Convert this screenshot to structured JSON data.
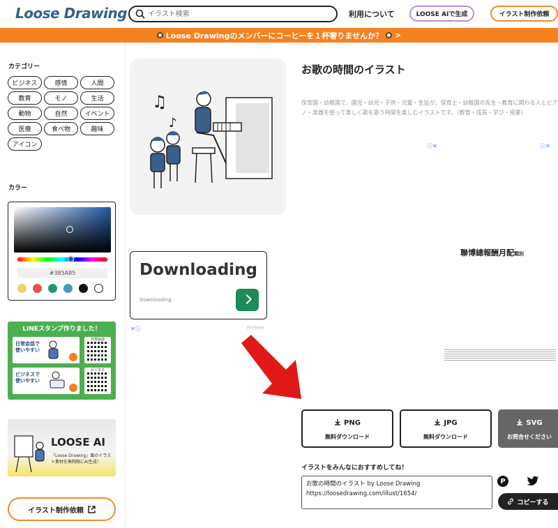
{
  "header": {
    "logo": "Loose Drawing",
    "search_placeholder": "イラスト検索",
    "about": "利用について",
    "ai_button": "LOOSE AIで生成",
    "request_button": "イラスト制作依頼"
  },
  "banner": {
    "text": "Loose Drawingのメンバーにコーヒーを１杯奢りませんか？",
    "arrow": ">"
  },
  "sidebar": {
    "category_title": "カテゴリー",
    "categories": [
      "ビジネス",
      "感情",
      "人間",
      "教育",
      "モノ",
      "生活",
      "動物",
      "自然",
      "イベント",
      "医療",
      "食べ物",
      "趣味",
      "アイコン"
    ],
    "color_title": "カラー",
    "hex_value": "#385A85",
    "swatches": [
      "#e8d66e",
      "#e0534d",
      "#1e9a6a",
      "#4a9ac0",
      "#111111",
      "#ffffff"
    ],
    "line_promo": {
      "title": "LINEスタンプ作りました！",
      "card1": "日常会話で\n使いやすい",
      "card2": "ビジネスで\n使いやすい",
      "qr1": "日常会話",
      "qr2": "ビジネス"
    },
    "ai_promo": {
      "title": "LOOSE AI",
      "subtitle": "「Loose Drawing」風のイラスト素材を無制限にAI生成！"
    },
    "request_button": "イラスト制作依頼"
  },
  "main": {
    "title": "お歌の時間のイラスト",
    "description": "保育園・幼稚園で、園児・幼児・子供・児童・生徒が、保育士・幼稚園の先生・教育に関わる人とピアノ・楽器を使って楽しく歌を歌う時間を楽しむイラストです。（教育・成長・学び・授業）",
    "ad": {
      "headline": "Downloading",
      "small": "Downloading",
      "x": "✕ⓘ",
      "pref": "Prefere"
    },
    "adchoice": "ⓘ✕",
    "ad_text": "聯博總報酬月配",
    "ad_text_small": "類別",
    "downloads": [
      {
        "label": "PNG",
        "sub": "無料ダウンロード"
      },
      {
        "label": "JPG",
        "sub": "無料ダウンロード"
      },
      {
        "label": "SVG",
        "sub": "お問合せください"
      }
    ],
    "share_title": "イラストをみんなにおすすめしてね！",
    "share_text": "お歌の時間のイラスト by Loose Drawing\nhttps://loosedrawing.com/illust/1654/",
    "copy_button": "コピーする",
    "pinterest": "P"
  }
}
